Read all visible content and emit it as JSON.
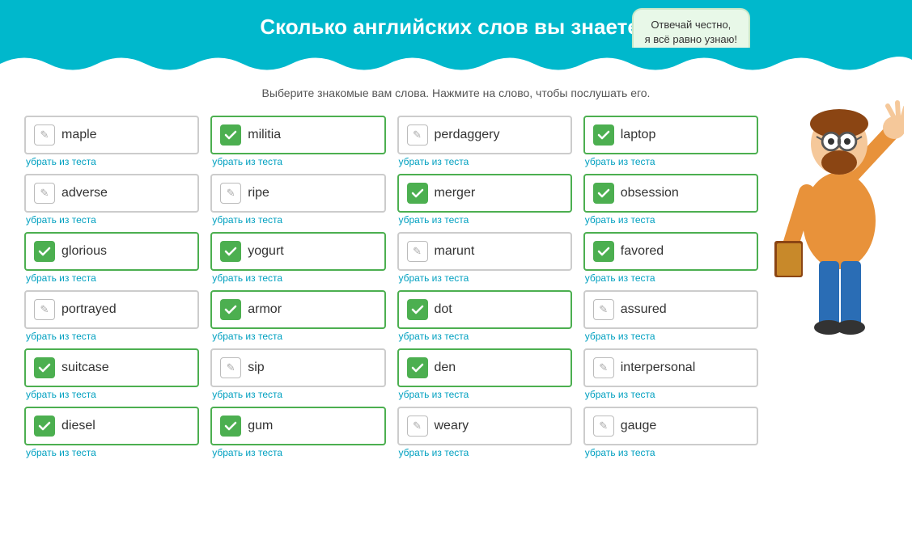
{
  "header": {
    "title": "Сколько английских слов вы знаете?",
    "bubble_line1": "Отвечай честно,",
    "bubble_line2": "я всё равно узнаю!"
  },
  "subtitle": "Выберите знакомые вам слова. Нажмите на слово, чтобы послушать его.",
  "words": [
    {
      "word": "maple",
      "checked": false,
      "col": 0
    },
    {
      "word": "militia",
      "checked": true,
      "col": 1
    },
    {
      "word": "perdaggery",
      "checked": false,
      "col": 2
    },
    {
      "word": "laptop",
      "checked": true,
      "col": 3
    },
    {
      "word": "adverse",
      "checked": false,
      "col": 0
    },
    {
      "word": "ripe",
      "checked": false,
      "col": 1
    },
    {
      "word": "merger",
      "checked": true,
      "col": 2
    },
    {
      "word": "obsession",
      "checked": true,
      "col": 3
    },
    {
      "word": "glorious",
      "checked": true,
      "col": 0
    },
    {
      "word": "yogurt",
      "checked": true,
      "col": 1
    },
    {
      "word": "marunt",
      "checked": false,
      "col": 2
    },
    {
      "word": "favored",
      "checked": true,
      "col": 3
    },
    {
      "word": "portrayed",
      "checked": false,
      "col": 0
    },
    {
      "word": "armor",
      "checked": true,
      "col": 1
    },
    {
      "word": "dot",
      "checked": true,
      "col": 2
    },
    {
      "word": "assured",
      "checked": false,
      "col": 3
    },
    {
      "word": "suitcase",
      "checked": true,
      "col": 0
    },
    {
      "word": "sip",
      "checked": false,
      "col": 1
    },
    {
      "word": "den",
      "checked": true,
      "col": 2
    },
    {
      "word": "interpersonal",
      "checked": false,
      "col": 3
    },
    {
      "word": "diesel",
      "checked": true,
      "col": 0
    },
    {
      "word": "gum",
      "checked": true,
      "col": 1
    },
    {
      "word": "weary",
      "checked": false,
      "col": 2
    },
    {
      "word": "gauge",
      "checked": false,
      "col": 3
    }
  ],
  "remove_label": "убрать из теста"
}
